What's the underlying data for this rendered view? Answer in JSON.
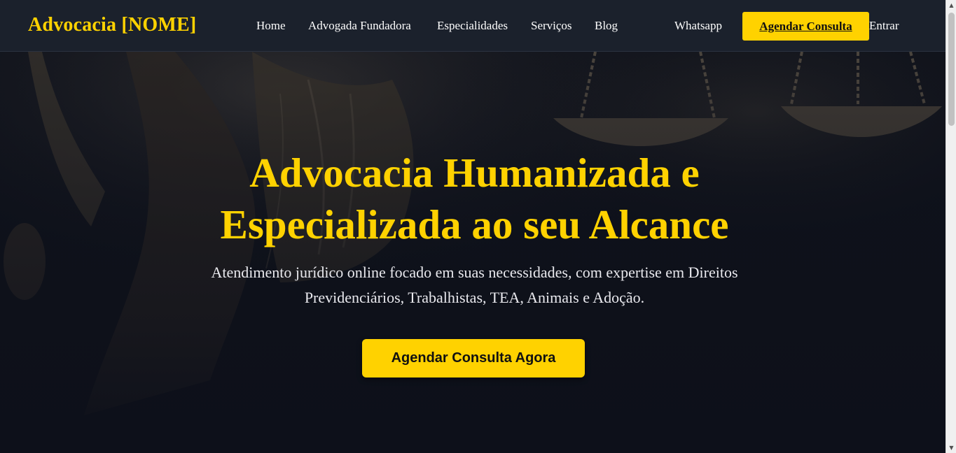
{
  "header": {
    "brand": "Advocacia [NOME]",
    "nav": [
      {
        "label": "Home"
      },
      {
        "label": "Advogada Fundadora"
      },
      {
        "label": "Especialidades"
      },
      {
        "label": "Serviços"
      },
      {
        "label": "Blog"
      },
      {
        "label": "Whatsapp"
      }
    ],
    "cta_label": "Agendar Consulta",
    "login_label": "Entrar"
  },
  "hero": {
    "title": "Advocacia Humanizada e Especializada ao seu Alcance",
    "subtitle": "Atendimento jurídico online focado em suas necessidades, com expertise em Direitos Previdenciários, Trabalhistas, TEA, Animais e Adoção.",
    "cta_label": "Agendar Consulta Agora",
    "background": "justice-statue-with-scales-image"
  },
  "colors": {
    "accent": "#ffd200",
    "header_bg": "#1b212c",
    "hero_bg": "#0d101a",
    "text_light": "#ffffff"
  },
  "icons": {
    "scroll_up": "scroll-up-arrow-icon",
    "scroll_down": "scroll-down-arrow-icon"
  }
}
